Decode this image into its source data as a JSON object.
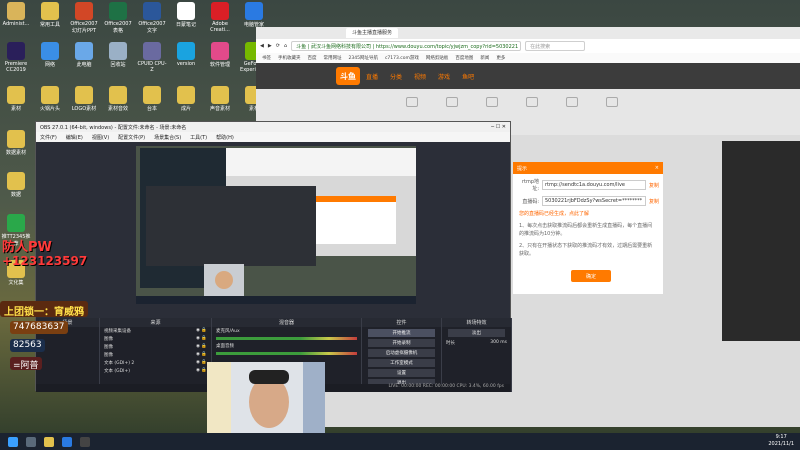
{
  "desktop": {
    "icons": [
      {
        "label": "Administ...",
        "color": "#d9b45a"
      },
      {
        "label": "常用工具",
        "color": "#e2c14d"
      },
      {
        "label": "Office2007 幻灯片PPT",
        "color": "#d24726"
      },
      {
        "label": "Office2007 表格",
        "color": "#1e7145"
      },
      {
        "label": "Office2007 文字",
        "color": "#2b579a"
      },
      {
        "label": "日蒙笔记",
        "color": "#ffffff"
      },
      {
        "label": "Adobe Creati...",
        "color": "#da1f26"
      },
      {
        "label": "电脑管家",
        "color": "#2a7ae2"
      },
      {
        "label": "Premiere CC2019",
        "color": "#2a1f5a"
      },
      {
        "label": "网络",
        "color": "#3a8ee6"
      },
      {
        "label": "此电脑",
        "color": "#6aa8e8"
      },
      {
        "label": "回收站",
        "color": "#9ab0c6"
      },
      {
        "label": "CPUID CPU-Z",
        "color": "#6a6aa0"
      },
      {
        "label": "version",
        "color": "#1aa3e0"
      },
      {
        "label": "软件管理",
        "color": "#e24a8a"
      },
      {
        "label": "GeForce Experience",
        "color": "#76b900"
      },
      {
        "label": "素材",
        "color": "#e2c14d"
      },
      {
        "label": "火锅片头",
        "color": "#e2c14d"
      },
      {
        "label": "LOGO素材",
        "color": "#e2c14d"
      },
      {
        "label": "素材音效",
        "color": "#e2c14d"
      },
      {
        "label": "台本",
        "color": "#e2c14d"
      },
      {
        "label": "成片",
        "color": "#e2c14d"
      },
      {
        "label": "声音素材",
        "color": "#e2c14d"
      },
      {
        "label": "素材",
        "color": "#e2c14d"
      },
      {
        "label": "数据素材",
        "color": "#e2c14d"
      },
      {
        "label": "数据",
        "color": "#e2c14d"
      },
      {
        "label": "推TT2345推荐",
        "color": "#2aa84a"
      },
      {
        "label": "文化集",
        "color": "#e2c14d"
      }
    ]
  },
  "browser": {
    "tab": "斗鱼主播直播服务",
    "url": "斗鱼 | 武汉斗鱼网络科技有限公司 | https://www.douyu.com/topic/yjwjzm_copy?rid=5030221",
    "search_placeholder": "在此搜索",
    "bookmarks": [
      "书签",
      "手机收藏夹",
      "百度",
      "常用网址",
      "2345网址导航",
      "c7173.com游戏",
      "网络剪贴板",
      "百度地图",
      "新闻",
      "更多"
    ],
    "site_logo": "斗鱼",
    "site_nav": [
      "直播",
      "分类",
      "视频",
      "游戏",
      "鱼吧"
    ],
    "menu_icons": 6
  },
  "dialog": {
    "title": "提示",
    "rtmp_label": "rtmp地址:",
    "rtmp_value": "rtmp://sendtc1a.douyu.com/live",
    "key_label": "直播码:",
    "key_value": "5030221rjbFDdzSy?wsSecret=********",
    "copy": "复制",
    "warn": "您的直播码已经生成，点此了解",
    "note1": "1、每次点击获取推流码后都会重新生成直播码，每个直播间的推流码为10分钟。",
    "note2": "2、只有在开播状态下获取的推流码才有效，过期后需要重新获取。",
    "button": "确定"
  },
  "obs": {
    "title": "OBS 27.0.1 (64-bit, windows) - 配置文件:未命名 - 场景:未命名",
    "menu": [
      "文件(F)",
      "编辑(E)",
      "视图(V)",
      "配置文件(P)",
      "场景集合(S)",
      "工具(T)",
      "帮助(H)"
    ],
    "docks": {
      "scenes": "场景",
      "sources": "来源",
      "mixer": "混音器",
      "transitions": "转场特效",
      "controls": "控件"
    },
    "sources": [
      {
        "name": "视频采集设备"
      },
      {
        "name": "图像"
      },
      {
        "name": "图像"
      },
      {
        "name": "图像"
      },
      {
        "name": "文本 (GDI+) 2"
      },
      {
        "name": "文本 (GDI+)"
      }
    ],
    "mixer": [
      "麦克风/Aux",
      "桌面音频"
    ],
    "controls": [
      "开始推流",
      "开始录制",
      "启动虚拟摄像机",
      "工作室模式",
      "设置",
      "退出"
    ],
    "transition": "淡出",
    "duration_label": "时长",
    "duration_value": "300 ms",
    "status": "LIVE: 00:00:00   REC: 00:00:00   CPU: 3.4%, 60.00 fps"
  },
  "overlays": {
    "line1": "防人PW",
    "line2": "+123123597",
    "line3": "上团锁一：宵威鸦",
    "line4": "747683637",
    "line5": "82563",
    "line6": "=阿普"
  },
  "taskbar": {
    "time": "9:17",
    "date": "2021/11/1"
  }
}
